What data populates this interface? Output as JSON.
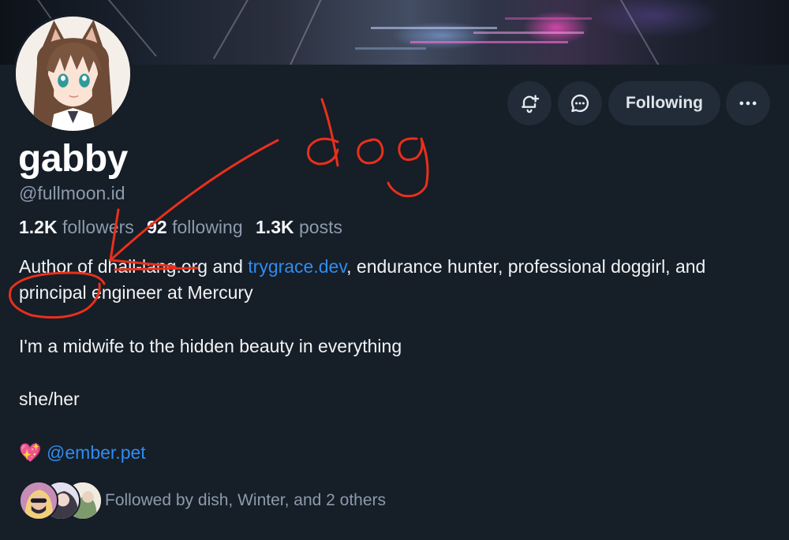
{
  "profile": {
    "display_name": "gabby",
    "handle": "@fullmoon.id",
    "followers_count": "1.2K",
    "followers_label": "followers",
    "following_count": "92",
    "following_label": "following",
    "posts_count": "1.3K",
    "posts_label": "posts"
  },
  "actions": {
    "notify_icon": "bell-plus-icon",
    "message_icon": "chat-bubble-icon",
    "following_label": "Following",
    "more_icon": "more-horizontal-icon"
  },
  "bio": {
    "line1_pre": "Author of dhall-lang.org and ",
    "line1_link": "trygrace.dev",
    "line1_post": ", endurance hunter, professional doggirl, and principal engineer at Mercury",
    "line2": "I'm a midwife to the hidden beauty in everything",
    "line3": "she/her",
    "line4_emoji": "💖",
    "line4_link": "@ember.pet"
  },
  "followed_by": {
    "text": "Followed by dish, Winter, and 2 others",
    "avatars": [
      "follower-avatar-dish",
      "follower-avatar-winter",
      "follower-avatar-other"
    ]
  },
  "annotation": {
    "text": "dog",
    "color": "#e8301c"
  },
  "colors": {
    "background": "#161e27",
    "button": "#222c38",
    "link": "#2f8cf0",
    "muted": "#8c9bad",
    "annotation": "#e8301c"
  }
}
